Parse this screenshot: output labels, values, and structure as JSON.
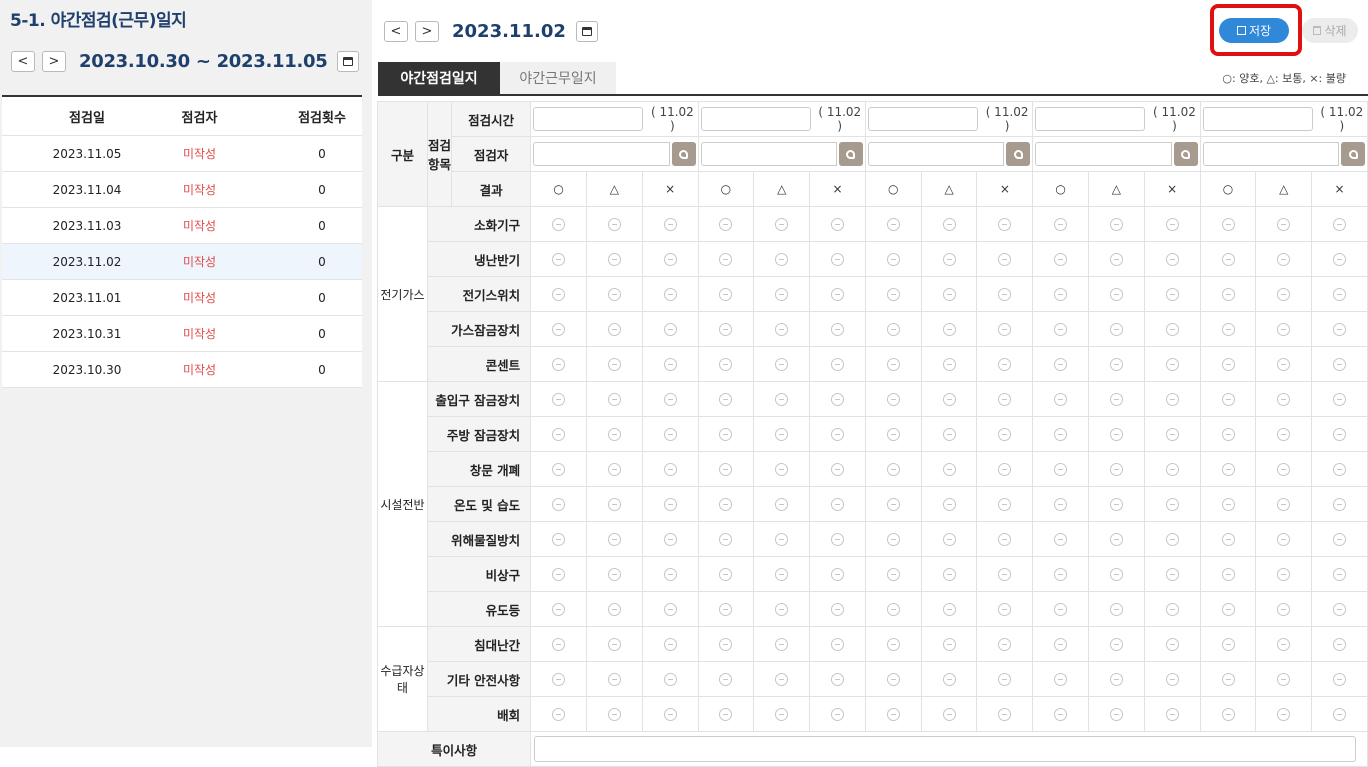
{
  "sidebar": {
    "title": "5-1. 야간점검(근무)일지",
    "range": "2023.10.30 ~ 2023.11.05",
    "headers": [
      "점검일",
      "점검자",
      "점검횟수"
    ],
    "rows": [
      {
        "date": "2023.11.05",
        "inspector": "미작성",
        "count": "0"
      },
      {
        "date": "2023.11.04",
        "inspector": "미작성",
        "count": "0"
      },
      {
        "date": "2023.11.03",
        "inspector": "미작성",
        "count": "0"
      },
      {
        "date": "2023.11.02",
        "inspector": "미작성",
        "count": "0"
      },
      {
        "date": "2023.11.01",
        "inspector": "미작성",
        "count": "0"
      },
      {
        "date": "2023.10.31",
        "inspector": "미작성",
        "count": "0"
      },
      {
        "date": "2023.10.30",
        "inspector": "미작성",
        "count": "0"
      }
    ],
    "selected_index": 3
  },
  "main": {
    "date": "2023.11.02",
    "save_label": "저장",
    "delete_label": "삭제",
    "tabs": [
      "야간점검일지",
      "야간근무일지"
    ],
    "legend": "○: 양호, △: 보통, ×: 불량",
    "header": {
      "category": "구분",
      "item_label": "점검\n항목",
      "time_label": "점검시간",
      "inspector_label": "점검자",
      "result_label": "결과",
      "time_date": "( 11.02 )",
      "symbols": [
        "○",
        "△",
        "×"
      ]
    },
    "round_count": 5,
    "groups": [
      {
        "name": "전기가스",
        "items": [
          "소화기구",
          "냉난반기",
          "전기스위치",
          "가스잠금장치",
          "콘센트"
        ]
      },
      {
        "name": "시설전반",
        "items": [
          "출입구 잠금장치",
          "주방 잠금장치",
          "창문 개폐",
          "온도 및 습도",
          "위해물질방치",
          "비상구",
          "유도등"
        ]
      },
      {
        "name": "수급자상태",
        "items": [
          "침대난간",
          "기타 안전사항",
          "배회"
        ]
      }
    ],
    "notes_label": "특이사항"
  },
  "colors": {
    "title": "#1f3f6d",
    "save_button": "#2f88d8",
    "highlight_border": "#e01010",
    "unwritten": "#e04a4a",
    "person_button": "#a79a8e"
  }
}
